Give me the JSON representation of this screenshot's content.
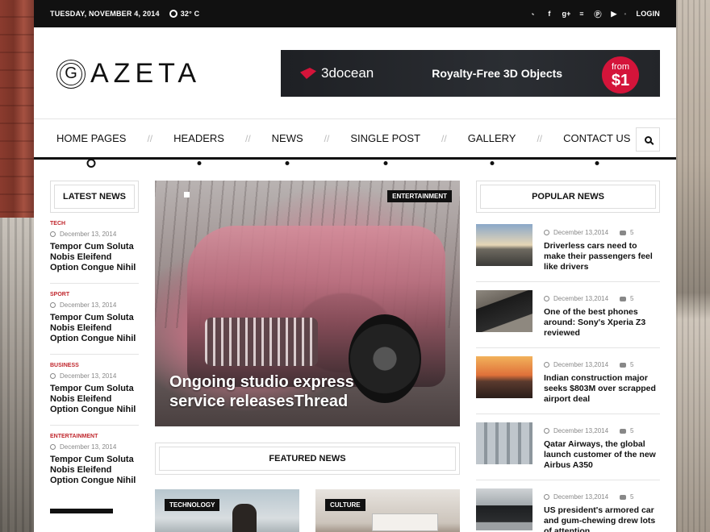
{
  "topbar": {
    "date": "TUESDAY, NOVEMBER 4, 2014",
    "weather": "32° C",
    "social_icons": [
      "twitter-icon",
      "facebook-icon",
      "google-plus-icon",
      "rss-icon",
      "pinterest-icon",
      "youtube-icon"
    ],
    "social_glyphs": [
      "˞",
      "f",
      "g+",
      "≡",
      "Ⓟ",
      "▶"
    ],
    "login": "LOGIN"
  },
  "header": {
    "logo_letter": "G",
    "logo_text": "AZETA",
    "banner": {
      "brand": "3docean",
      "tagline": "Royalty-Free 3D Objects",
      "price_prefix": "from",
      "price": "$1"
    }
  },
  "nav": {
    "items": [
      "HOME PAGES",
      "HEADERS",
      "NEWS",
      "SINGLE POST",
      "GALLERY",
      "CONTACT US"
    ],
    "divider": "//"
  },
  "latest": {
    "title": "LATEST NEWS",
    "items": [
      {
        "category": "TECH",
        "date": "December 13, 2014",
        "title": "Tempor Cum Soluta Nobis Eleifend Option Congue Nihil"
      },
      {
        "category": "SPORT",
        "date": "December 13, 2014",
        "title": "Tempor Cum Soluta Nobis Eleifend Option Congue Nihil"
      },
      {
        "category": "BUSINESS",
        "date": "December 13, 2014",
        "title": "Tempor Cum Soluta Nobis Eleifend Option Congue Nihil"
      },
      {
        "category": "ENTERTAINMENT",
        "date": "December 13, 2014",
        "title": "Tempor Cum Soluta Nobis Eleifend Option Congue Nihil"
      }
    ]
  },
  "hero": {
    "category": "ENTERTAINMENT",
    "headline": "Ongoing studio express service releasesThread"
  },
  "featured": {
    "title": "FEATURED NEWS",
    "cards": [
      {
        "category": "TECHNOLOGY"
      },
      {
        "category": "CULTURE"
      }
    ]
  },
  "popular": {
    "title": "POPULAR NEWS",
    "items": [
      {
        "date": "December 13,2014",
        "comments": "5",
        "title": "Driverless cars need to make their passengers feel like drivers"
      },
      {
        "date": "December 13,2014",
        "comments": "5",
        "title": "One of the best phones around: Sony's Xperia Z3 reviewed"
      },
      {
        "date": "December 13,2014",
        "comments": "5",
        "title": "Indian construction major seeks $803M over scrapped airport deal"
      },
      {
        "date": "December 13,2014",
        "comments": "5",
        "title": "Qatar Airways, the global launch customer of the new Airbus A350"
      },
      {
        "date": "December 13,2014",
        "comments": "5",
        "title": "US president's armored car and gum-chewing drew lots of attention"
      }
    ]
  },
  "colors": {
    "accent_red": "#c0272d",
    "topbar_bg": "#111111",
    "banner_price_bg": "#d4143a"
  }
}
